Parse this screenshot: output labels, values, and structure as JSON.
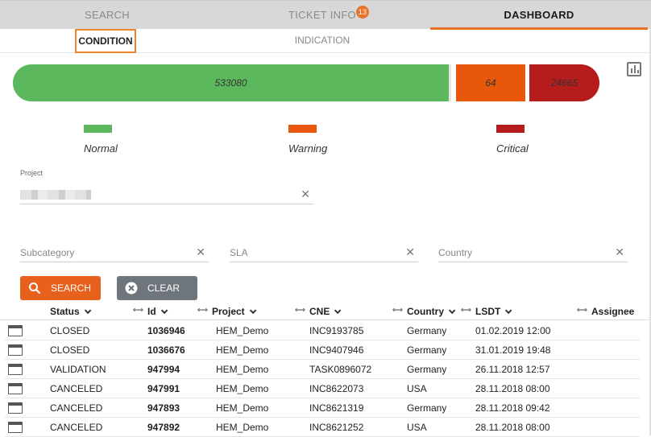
{
  "top_tabs": [
    {
      "label": "SEARCH"
    },
    {
      "label": "TICKET INFO",
      "badge": "13"
    },
    {
      "label": "DASHBOARD"
    }
  ],
  "sub_tabs": [
    {
      "label": "CONDITION"
    },
    {
      "label": "INDICATION"
    }
  ],
  "status_bar": {
    "normal": "533080",
    "warning": "64",
    "critical": "24665"
  },
  "legend": [
    {
      "label": "Normal",
      "color": "#5cb85c"
    },
    {
      "label": "Warning",
      "color": "#e8580c"
    },
    {
      "label": "Critical",
      "color": "#b71c1c"
    }
  ],
  "filters": {
    "project_label": "Project",
    "subcategory_placeholder": "Subcategory",
    "sla_placeholder": "SLA",
    "country_placeholder": "Country",
    "clear_symbol": "✕"
  },
  "buttons": {
    "search": "SEARCH",
    "clear": "CLEAR"
  },
  "table": {
    "columns": [
      "Status",
      "Id",
      "Project",
      "CNE",
      "Country",
      "LSDT",
      "Assignee"
    ],
    "rows": [
      [
        "CLOSED",
        "1036946",
        "HEM_Demo",
        "INC9193785",
        "Germany",
        "01.02.2019 12:00"
      ],
      [
        "CLOSED",
        "1036676",
        "HEM_Demo",
        "INC9407946",
        "Germany",
        "31.01.2019 19:48"
      ],
      [
        "VALIDATION",
        "947994",
        "HEM_Demo",
        "TASK0896072",
        "Germany",
        "26.11.2018 12:57"
      ],
      [
        "CANCELED",
        "947991",
        "HEM_Demo",
        "INC8622073",
        "USA",
        "28.11.2018 08:00"
      ],
      [
        "CANCELED",
        "947893",
        "HEM_Demo",
        "INC8621319",
        "Germany",
        "28.11.2018 09:42"
      ],
      [
        "CANCELED",
        "947892",
        "HEM_Demo",
        "INC8621252",
        "USA",
        "28.11.2018 08:00"
      ]
    ]
  },
  "colors": {
    "accent": "#e8732b",
    "normal": "#5cb85c",
    "warning": "#e8580c",
    "critical": "#b71c1c"
  }
}
